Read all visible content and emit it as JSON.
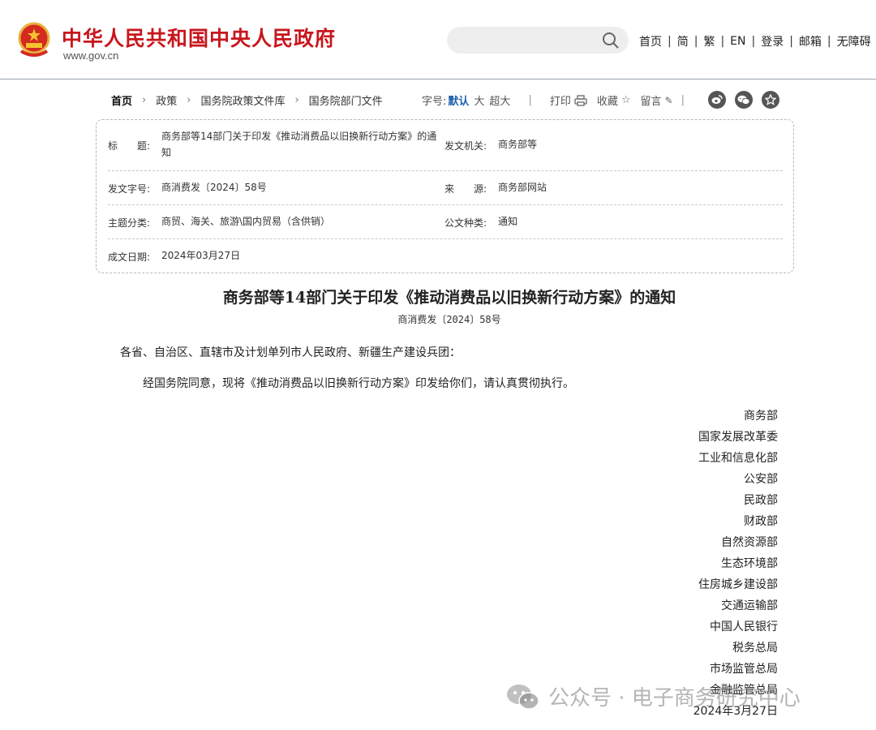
{
  "header": {
    "site_title": "中华人民共和国中央人民政府",
    "site_url": "www.gov.cn",
    "search": {
      "placeholder": ""
    },
    "nav": [
      "首页",
      "简",
      "繁",
      "EN",
      "登录",
      "邮箱",
      "无障碍"
    ]
  },
  "breadcrumb": [
    "首页",
    "政策",
    "国务院政策文件库",
    "国务院部门文件"
  ],
  "toolbar": {
    "font_size_label": "字号:",
    "font_default": "默认",
    "font_large": "大",
    "font_xlarge": "超大",
    "print": "打印",
    "favorite": "收藏",
    "comment": "留言"
  },
  "info": {
    "title_label": "标　　题:",
    "title_value": "商务部等14部门关于印发《推动消费品以旧换新行动方案》的通知",
    "issuer_label": "发文机关:",
    "issuer_value": "商务部等",
    "docno_label": "发文字号:",
    "docno_value": "商消费发〔2024〕58号",
    "source_label": "来　　源:",
    "source_value": "商务部网站",
    "topic_label": "主题分类:",
    "topic_value": "商贸、海关、旅游\\国内贸易（含供销）",
    "type_label": "公文种类:",
    "type_value": "通知",
    "date_label": "成文日期:",
    "date_value": "2024年03月27日"
  },
  "document": {
    "title": "商务部等14部门关于印发《推动消费品以旧换新行动方案》的通知",
    "number": "商消费发〔2024〕58号",
    "salutation": "各省、自治区、直辖市及计划单列市人民政府、新疆生产建设兵团：",
    "body": "经国务院同意，现将《推动消费品以旧换新行动方案》印发给你们，请认真贯彻执行。",
    "signers": [
      "商务部",
      "国家发展改革委",
      "工业和信息化部",
      "公安部",
      "民政部",
      "财政部",
      "自然资源部",
      "生态环境部",
      "住房城乡建设部",
      "交通运输部",
      "中国人民银行",
      "税务总局",
      "市场监管总局",
      "金融监管总局"
    ],
    "date": "2024年3月27日"
  },
  "watermark": {
    "text": "公众号 · 电子商务研究中心"
  },
  "colors": {
    "brand_red": "#c8161d",
    "link_blue": "#1d5fa8"
  }
}
